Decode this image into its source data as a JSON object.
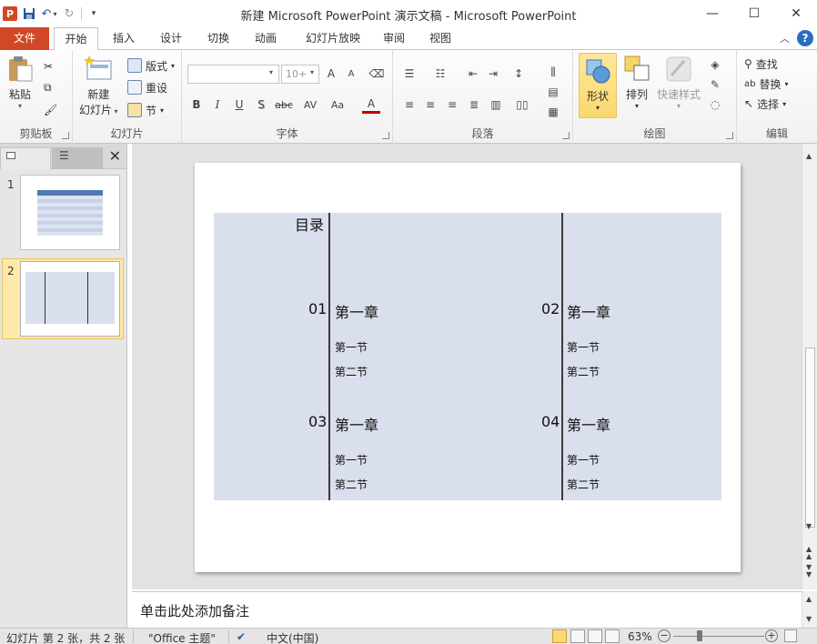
{
  "titlebar": {
    "title": "新建 Microsoft PowerPoint 演示文稿 - Microsoft PowerPoint",
    "app_icon": "P"
  },
  "tabs": [
    {
      "label": "文件"
    },
    {
      "label": "开始"
    },
    {
      "label": "插入"
    },
    {
      "label": "设计"
    },
    {
      "label": "切换"
    },
    {
      "label": "动画"
    },
    {
      "label": "幻灯片放映"
    },
    {
      "label": "审阅"
    },
    {
      "label": "视图"
    }
  ],
  "ribbon": {
    "clipboard": {
      "label": "剪贴板",
      "paste": "粘贴"
    },
    "slides": {
      "label": "幻灯片",
      "new_slide_1": "新建",
      "new_slide_2": "幻灯片",
      "layout": "版式",
      "reset": "重设",
      "section": "节"
    },
    "font": {
      "label": "字体",
      "font_name": "",
      "font_size": "10+",
      "bold": "B",
      "italic": "I",
      "underline": "U",
      "shadow": "S",
      "strike": "abc",
      "spacing": "AV",
      "case": "Aa",
      "color": "A",
      "grow": "A",
      "shrink": "A"
    },
    "paragraph": {
      "label": "段落"
    },
    "drawing": {
      "label": "绘图",
      "shapes": "形状",
      "arrange": "排列",
      "quick_styles": "快速样式"
    },
    "editing": {
      "label": "编辑",
      "find": "查找",
      "replace": "替换",
      "select": "选择"
    }
  },
  "accent_color": "#d24726",
  "slides": [
    {
      "number": "1"
    },
    {
      "number": "2"
    }
  ],
  "slide": {
    "toc_title": "目录",
    "chapters": [
      {
        "num": "01",
        "title": "第一章",
        "s1": "第一节",
        "s2": "第二节"
      },
      {
        "num": "02",
        "title": "第一章",
        "s1": "第一节",
        "s2": "第二节"
      },
      {
        "num": "03",
        "title": "第一章",
        "s1": "第一节",
        "s2": "第二节"
      },
      {
        "num": "04",
        "title": "第一章",
        "s1": "第一节",
        "s2": "第二节"
      }
    ]
  },
  "notes_placeholder": "单击此处添加备注",
  "status": {
    "slide_info": "幻灯片 第 2 张，共 2 张",
    "theme": "\"Office 主题\"",
    "language": "中文(中国)",
    "zoom": "63%"
  }
}
